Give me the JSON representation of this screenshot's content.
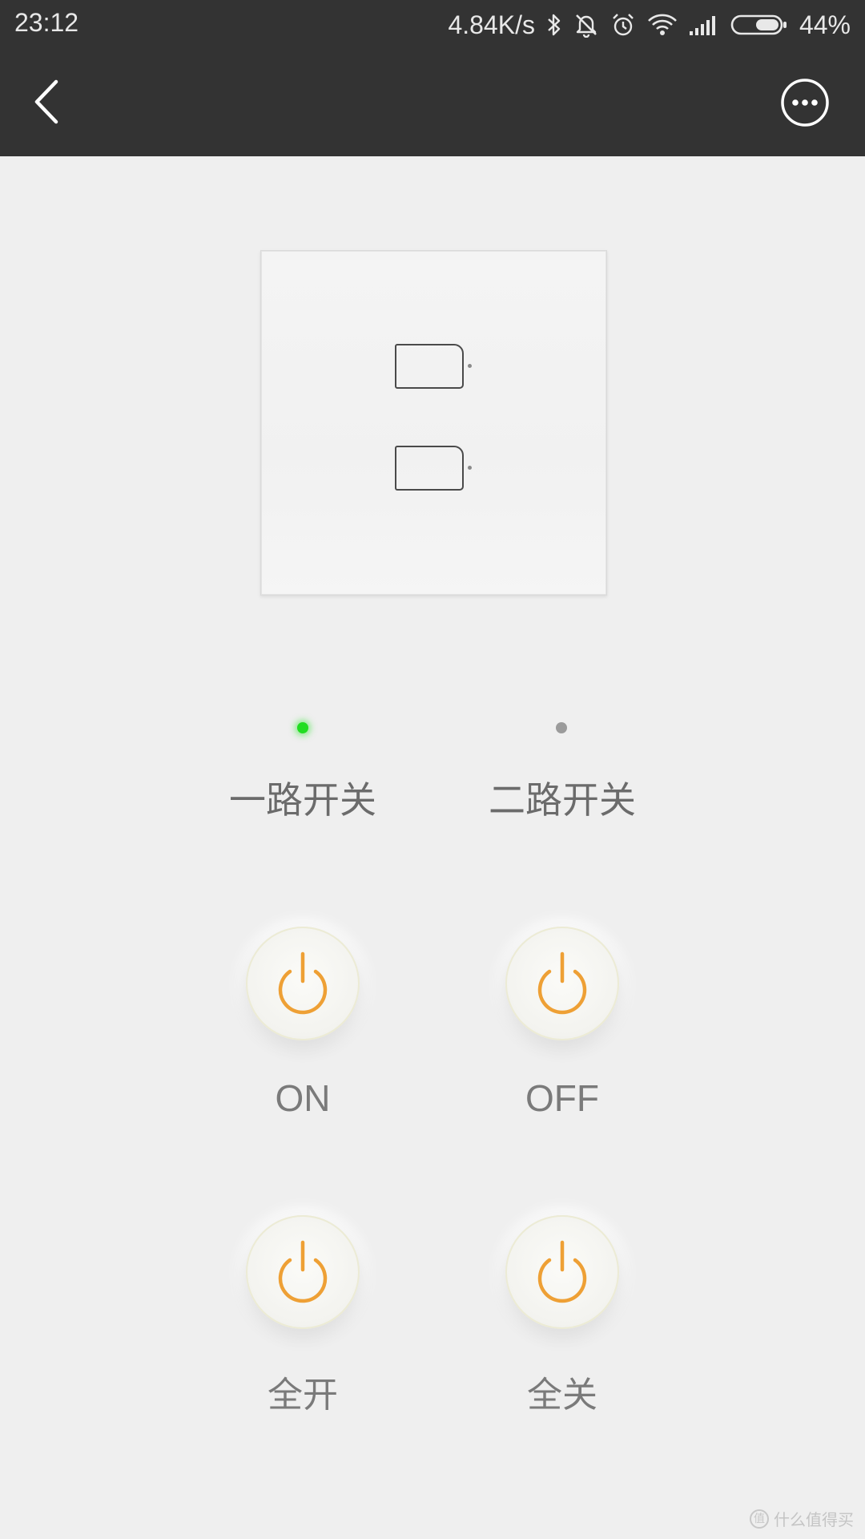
{
  "status_bar": {
    "time": "23:12",
    "network_speed": "4.84K/s",
    "battery_percent": "44%",
    "icons": [
      "bluetooth-icon",
      "mute-bell-icon",
      "alarm-icon",
      "wifi-icon",
      "signal-icon",
      "battery-icon"
    ]
  },
  "app_bar": {
    "back_icon": "chevron-left-icon",
    "more_icon": "more-options-icon"
  },
  "switch_panel": {
    "keys": 2
  },
  "channels": [
    {
      "label": "一路开关",
      "state": "on",
      "indicator_color": "#22dd22"
    },
    {
      "label": "二路开关",
      "state": "off",
      "indicator_color": "#9b9b9b"
    }
  ],
  "buttons": {
    "on_label": "ON",
    "off_label": "OFF",
    "all_on_label": "全开",
    "all_off_label": "全关",
    "icon": "power-icon",
    "icon_color": "#eea035"
  },
  "watermark": {
    "logo_char": "值",
    "text": "什么值得买"
  },
  "colors": {
    "header_bg": "#333333",
    "page_bg": "#efefef",
    "accent": "#eea035"
  }
}
